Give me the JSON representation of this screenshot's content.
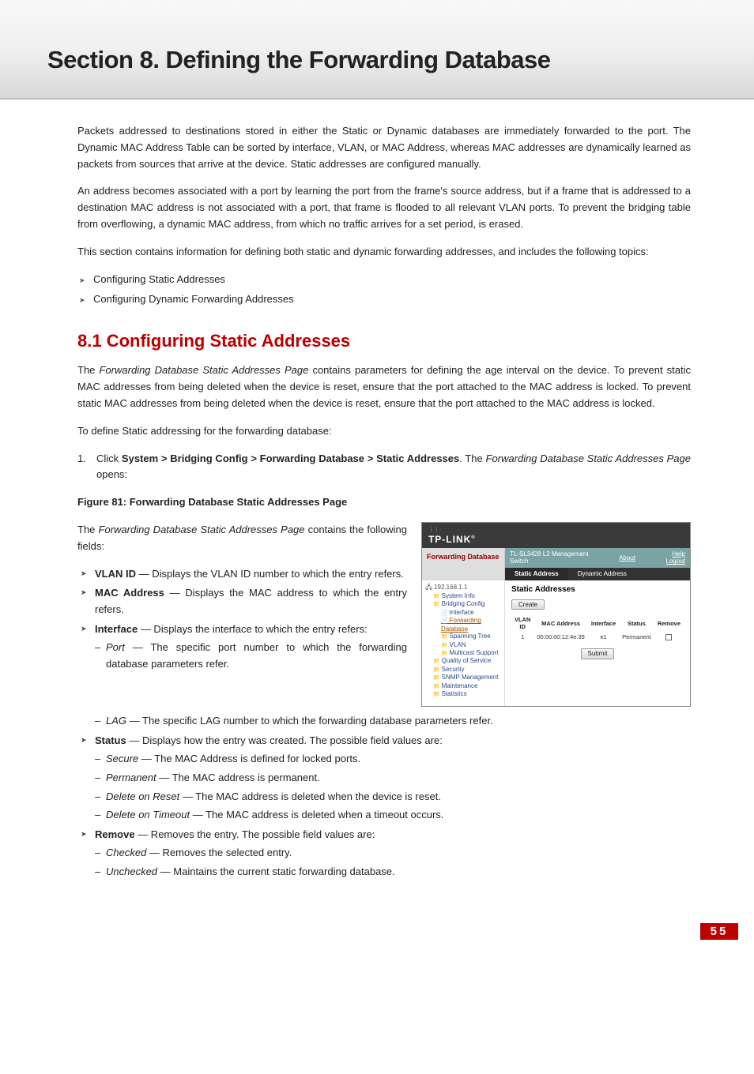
{
  "banner_title": "Section 8.  Defining the Forwarding Database",
  "para1": "Packets addressed to destinations stored in either the Static or Dynamic databases are immediately forwarded to the port. The Dynamic MAC Address Table can be sorted by interface, VLAN, or MAC Address, whereas MAC addresses are dynamically learned as packets from sources that arrive at the device. Static addresses are configured manually.",
  "para2": "An address becomes associated with a port by learning the port from the frame's source address, but if a frame that is addressed to a destination MAC address is not associated with a port, that frame is flooded to all relevant VLAN ports. To prevent the bridging table from overflowing, a dynamic MAC address, from which no traffic arrives for a set period, is erased.",
  "para3": "This section contains information for defining both static and dynamic forwarding addresses, and includes the following topics:",
  "topics": [
    "Configuring Static Addresses",
    "Configuring Dynamic Forwarding Addresses"
  ],
  "h2": "8.1   Configuring Static Addresses",
  "para4a": "The ",
  "para4b": "Forwarding Database Static Addresses Page",
  "para4c": " contains parameters for defining the age interval on the device. To prevent static MAC addresses from being deleted when the device is reset, ensure that the port attached to the MAC address is locked. To prevent static MAC addresses from being deleted when the device is reset, ensure that the port attached to the MAC address is locked.",
  "para5": "To define Static addressing for the forwarding database:",
  "step1_pre": "Click ",
  "step1_bold": "System > Bridging Config > Forwarding Database > Static Addresses",
  "step1_mid": ". The ",
  "step1_em": "Forwarding Database Static Addresses Page",
  "step1_post": " opens:",
  "fig_caption": "Figure 81: Forwarding Database Static Addresses Page",
  "intro_left_a": "The ",
  "intro_left_b": "Forwarding Database Static Addresses Page",
  "intro_left_c": " contains the following fields:",
  "fields": {
    "vlan_label": "VLAN ID",
    "vlan_desc": " — Displays the VLAN ID number to which the entry refers.",
    "mac_label": "MAC Address",
    "mac_desc": " — Displays the MAC address to which the entry refers.",
    "iface_label": "Interface",
    "iface_desc": " — Displays the interface to which the entry refers:",
    "port_label": "Port",
    "port_desc": " — The specific port number to which the forwarding database parameters refer.",
    "lag_label": "LAG",
    "lag_desc": " — The specific LAG number to which the forwarding database parameters refer.",
    "status_label": "Status",
    "status_desc": " — Displays how the entry was created. The possible field values are:",
    "secure_label": "Secure",
    "secure_desc": " — The MAC Address is defined for locked ports.",
    "perm_label": "Permanent",
    "perm_desc": " — The MAC address is permanent.",
    "delr_label": "Delete on Reset",
    "delr_desc": " — The MAC address is deleted when the device is reset.",
    "delt_label": "Delete on Timeout",
    "delt_desc": " — The MAC address is deleted when a timeout occurs.",
    "remove_label": "Remove",
    "remove_desc": " — Removes the entry. The possible field values are:",
    "checked_label": "Checked",
    "checked_desc": " — Removes the selected entry.",
    "unchecked_label": "Unchecked",
    "unchecked_desc": " — Maintains the current static forwarding database."
  },
  "shot": {
    "logo": "TP-LINK",
    "sidebar_title": "Forwarding Database",
    "title_line1": "TL-SL3428 L2 Management",
    "title_line2": "Switch",
    "about": "About",
    "help": "Help",
    "logout": "Logout",
    "tab_static": "Static Address",
    "tab_dynamic": "Dynamic Address",
    "tree_root": "192.168.1.1",
    "tree": {
      "sysinfo": "System Info",
      "bridging": "Bridging Config",
      "interface": "Interface",
      "fwd": "Forwarding Database",
      "span": "Spanning Tree",
      "vlan": "VLAN",
      "mcast": "Multicast Support",
      "qos": "Quality of Service",
      "sec": "Security",
      "snmp": "SNMP Management",
      "maint": "Maintenance",
      "stats": "Statistics"
    },
    "main_heading": "Static Addresses",
    "btn_create": "Create",
    "cols": {
      "vlan": "VLAN ID",
      "mac": "MAC Address",
      "iface": "Interface",
      "status": "Status",
      "remove": "Remove"
    },
    "row": {
      "vlan": "1",
      "mac": "00:00:00:12:4e:39",
      "iface": "e1",
      "status": "Permanent"
    },
    "btn_submit": "Submit"
  },
  "page_number": "55"
}
